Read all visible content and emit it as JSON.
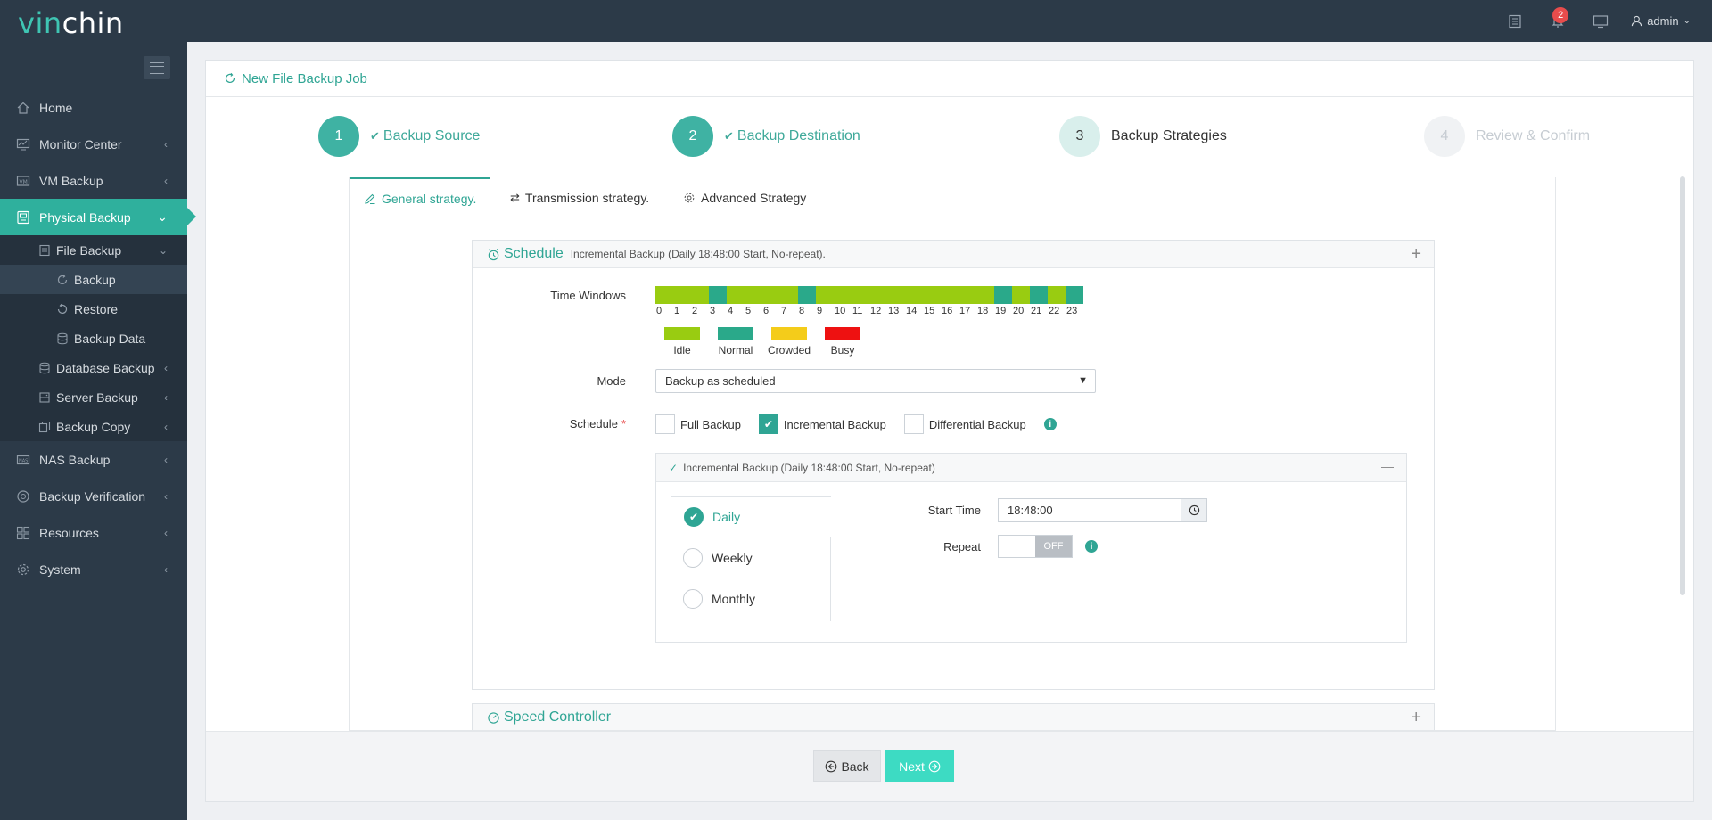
{
  "app": {
    "logo_v": "vin",
    "logo_rest": "chin",
    "badge_count": "2",
    "user": "admin"
  },
  "sidebar": {
    "items": [
      {
        "label": "Home",
        "icon": "home-icon"
      },
      {
        "label": "Monitor Center",
        "icon": "monitor-icon"
      },
      {
        "label": "VM Backup",
        "icon": "vm-icon"
      },
      {
        "label": "Physical Backup",
        "icon": "physical-icon"
      }
    ],
    "sub": {
      "file_backup": "File Backup",
      "backup": "Backup",
      "restore": "Restore",
      "backup_data": "Backup Data",
      "database_backup": "Database Backup",
      "server_backup": "Server Backup",
      "backup_copy": "Backup Copy"
    },
    "items_after": [
      {
        "label": "NAS Backup"
      },
      {
        "label": "Backup Verification"
      },
      {
        "label": "Resources"
      },
      {
        "label": "System"
      }
    ]
  },
  "page": {
    "title": "New File Backup Job"
  },
  "steps": [
    {
      "num": "1",
      "label": "Backup Source"
    },
    {
      "num": "2",
      "label": "Backup Destination"
    },
    {
      "num": "3",
      "label": "Backup Strategies"
    },
    {
      "num": "4",
      "label": "Review & Confirm"
    }
  ],
  "tabs": [
    {
      "label": "General strategy."
    },
    {
      "label": "Transmission strategy."
    },
    {
      "label": "Advanced Strategy"
    }
  ],
  "schedule_panel": {
    "title": "Schedule",
    "desc": "Incremental Backup (Daily 18:48:00 Start, No-repeat).",
    "time_windows_label": "Time Windows",
    "hours": [
      "0",
      "1",
      "2",
      "3",
      "4",
      "5",
      "6",
      "7",
      "8",
      "9",
      "10",
      "11",
      "12",
      "13",
      "14",
      "15",
      "16",
      "17",
      "18",
      "19",
      "20",
      "21",
      "22",
      "23"
    ],
    "hour_status": [
      "idle",
      "idle",
      "idle",
      "normal",
      "idle",
      "idle",
      "idle",
      "idle",
      "normal",
      "idle",
      "idle",
      "idle",
      "idle",
      "idle",
      "idle",
      "idle",
      "idle",
      "idle",
      "idle",
      "normal",
      "idle",
      "normal",
      "idle",
      "normal"
    ],
    "legend": [
      {
        "label": "Idle",
        "color": "#99cc11"
      },
      {
        "label": "Normal",
        "color": "#2aa98a"
      },
      {
        "label": "Crowded",
        "color": "#f4cc1a"
      },
      {
        "label": "Busy",
        "color": "#ee1111"
      }
    ],
    "mode_label": "Mode",
    "mode_value": "Backup as scheduled",
    "schedule_label": "Schedule",
    "required_mark": "*",
    "full_backup": "Full Backup",
    "incremental_backup": "Incremental Backup",
    "differential_backup": "Differential Backup",
    "sub_desc": "Incremental Backup (Daily 18:48:00 Start, No-repeat)",
    "freq": [
      "Daily",
      "Weekly",
      "Monthly"
    ],
    "start_time_label": "Start Time",
    "start_time": "18:48:00",
    "repeat_label": "Repeat",
    "repeat_state": "OFF"
  },
  "speed_panel": {
    "title": "Speed Controller"
  },
  "footer": {
    "back": "Back",
    "next": "Next"
  }
}
